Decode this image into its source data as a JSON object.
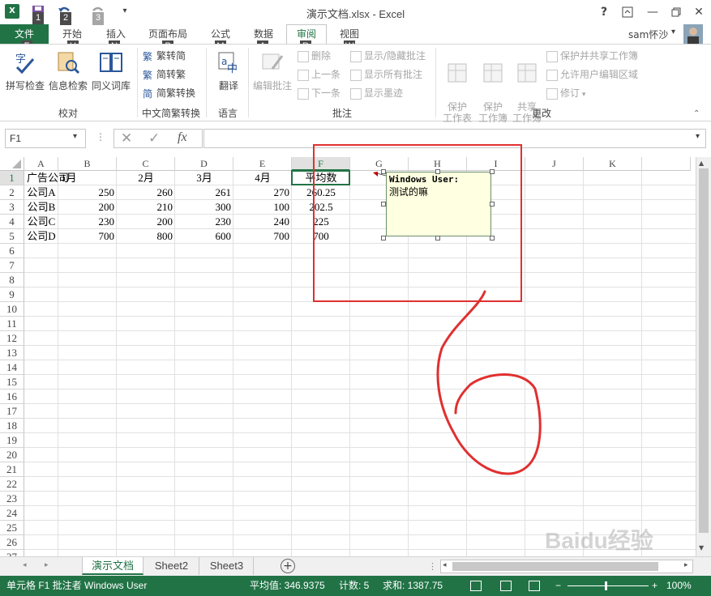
{
  "window": {
    "title": "演示文档.xlsx - Excel",
    "help": "?",
    "user": "sam怀沙"
  },
  "qat": {
    "keytips": [
      "1",
      "2",
      "3"
    ]
  },
  "tabs": [
    {
      "label": "文件",
      "keytip": "F"
    },
    {
      "label": "开始",
      "keytip": "H"
    },
    {
      "label": "插入",
      "keytip": "N"
    },
    {
      "label": "页面布局",
      "keytip": "P"
    },
    {
      "label": "公式",
      "keytip": "M"
    },
    {
      "label": "数据",
      "keytip": "A"
    },
    {
      "label": "审阅",
      "keytip": "R"
    },
    {
      "label": "视图",
      "keytip": "W"
    }
  ],
  "ribbon": {
    "proofing": {
      "spelling": "拼写检查",
      "research": "信息检索",
      "thesaurus": "同义词库",
      "label": "校对"
    },
    "chinese": {
      "t2s": "繁转简",
      "s2t": "简转繁",
      "convert": "简繁转换",
      "label": "中文简繁转换"
    },
    "language": {
      "translate": "翻译",
      "label": "语言"
    },
    "comments": {
      "edit": "编辑批注",
      "delete": "删除",
      "prev": "上一条",
      "next": "下一条",
      "show_hide": "显示/隐藏批注",
      "show_all": "显示所有批注",
      "show_ink": "显示墨迹",
      "label": "批注"
    },
    "changes": {
      "protect_sheet": "保护\n工作表",
      "protect_book": "保护\n工作簿",
      "share_book": "共享\n工作簿",
      "protect_share": "保护并共享工作簿",
      "allow_edit": "允许用户编辑区域",
      "track": "修订",
      "label": "更改"
    }
  },
  "formula_bar": {
    "namebox": "F1",
    "fx": "fx",
    "value": ""
  },
  "grid": {
    "columns": [
      "A",
      "B",
      "C",
      "D",
      "E",
      "F",
      "G",
      "H",
      "I",
      "J",
      "K"
    ],
    "rows": [
      "1",
      "2",
      "3",
      "4",
      "5",
      "6",
      "7",
      "8",
      "9",
      "10",
      "11",
      "12",
      "13",
      "14",
      "15",
      "16",
      "17",
      "18",
      "19",
      "20",
      "21",
      "22",
      "23",
      "24",
      "25",
      "26",
      "27"
    ],
    "data": [
      [
        "广告公司",
        "1月",
        "2月",
        "3月",
        "4月",
        "平均数"
      ],
      [
        "公司A",
        "250",
        "260",
        "261",
        "270",
        "260.25"
      ],
      [
        "公司B",
        "200",
        "210",
        "300",
        "100",
        "202.5"
      ],
      [
        "公司C",
        "230",
        "200",
        "230",
        "240",
        "225"
      ],
      [
        "公司D",
        "700",
        "800",
        "600",
        "700",
        "700"
      ]
    ]
  },
  "comment": {
    "author": "Windows User:",
    "text": "测试的嘛"
  },
  "sheets": [
    "演示文档",
    "Sheet2",
    "Sheet3"
  ],
  "status": {
    "left": "单元格 F1 批注者 Windows User",
    "average": "平均值: 346.9375",
    "count": "计数: 5",
    "sum": "求和: 1387.75",
    "zoom": "100%"
  },
  "watermark": "Baidu经验",
  "colors": {
    "excel_green": "#217346",
    "annotation_red": "#e03030",
    "comment_bg": "#ffffe1"
  }
}
